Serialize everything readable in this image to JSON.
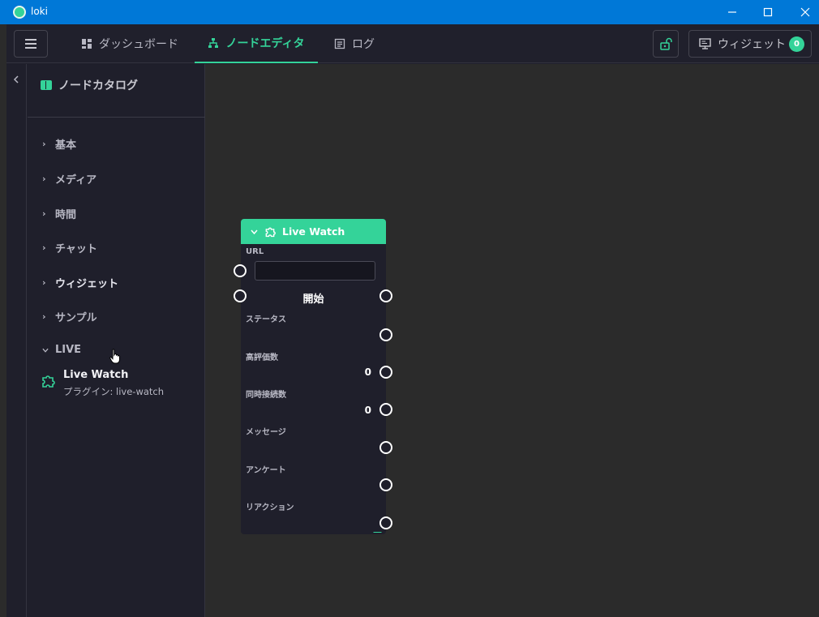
{
  "window": {
    "title": "loki"
  },
  "nav": {
    "tabs": [
      {
        "label": "ダッシュボード"
      },
      {
        "label": "ノードエディタ"
      },
      {
        "label": "ログ"
      }
    ],
    "widget_label": "ウィジェット",
    "widget_count": "0"
  },
  "sidebar": {
    "title": "ノードカタログ",
    "categories": [
      {
        "label": "基本"
      },
      {
        "label": "メディア"
      },
      {
        "label": "時間"
      },
      {
        "label": "チャット"
      },
      {
        "label": "ウィジェット"
      },
      {
        "label": "サンプル"
      },
      {
        "label": "LIVE"
      }
    ],
    "live_node": {
      "name": "Live Watch",
      "sub": "プラグイン: live-watch"
    }
  },
  "node": {
    "title": "Live Watch",
    "url_label": "URL",
    "url_value": "",
    "start_label": "開始",
    "rows": [
      {
        "label": "ステータス",
        "value": ""
      },
      {
        "label": "高評価数",
        "value": "0"
      },
      {
        "label": "同時接続数",
        "value": "0"
      },
      {
        "label": "メッセージ",
        "value": ""
      },
      {
        "label": "アンケート",
        "value": ""
      },
      {
        "label": "リアクション",
        "value": ""
      }
    ]
  },
  "colors": {
    "accent": "#34d399",
    "titlebar": "#0078d7",
    "panel": "#1f1f2b",
    "canvas": "#2b2b2b"
  },
  "icons": {
    "app": "loki-logo-icon",
    "dashboard": "dashboard-icon",
    "node_editor": "sitemap-icon",
    "log": "log-icon",
    "lock": "unlock-icon",
    "widget": "monitor-icon",
    "catalog": "book-icon",
    "plugin": "puzzle-icon"
  }
}
